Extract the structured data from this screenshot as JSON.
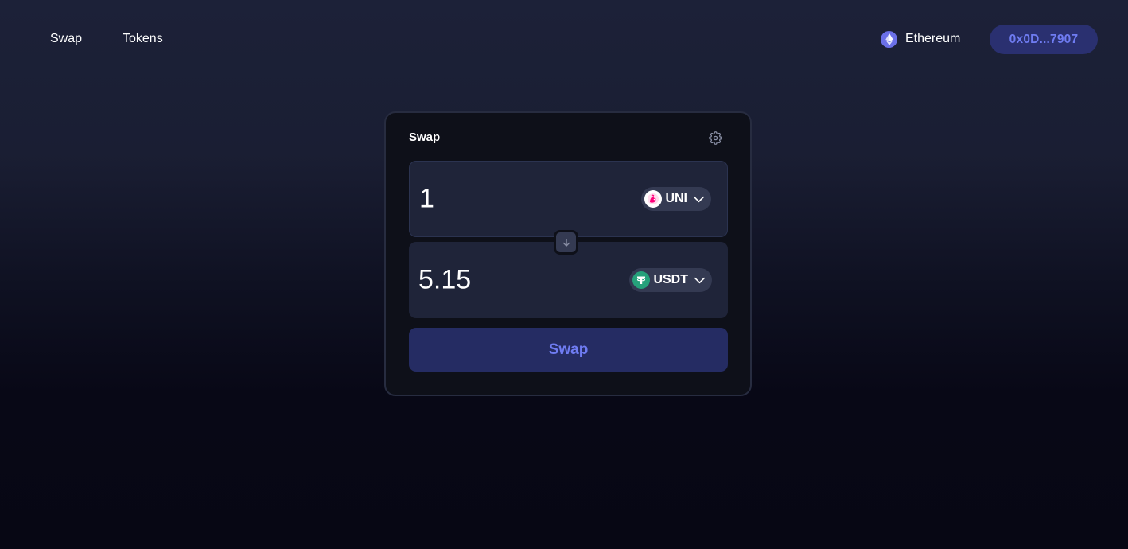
{
  "nav": {
    "items": [
      {
        "label": "Swap"
      },
      {
        "label": "Tokens"
      }
    ]
  },
  "network": {
    "label": "Ethereum",
    "icon": "ethereum-icon",
    "color": "#6b70e8"
  },
  "wallet": {
    "address": "0x0D...7907"
  },
  "swap_card": {
    "title": "Swap",
    "settings_icon": "gear-icon",
    "from": {
      "amount": "1",
      "token": "UNI",
      "token_icon": "uniswap-icon",
      "token_color": "#ff007a"
    },
    "to": {
      "amount": "5.15",
      "token": "USDT",
      "token_icon": "tether-icon",
      "token_color": "#26a17b"
    },
    "flip_icon": "arrow-down-icon",
    "submit_label": "Swap"
  },
  "colors": {
    "accent": "#6f7cf2",
    "button_bg": "#252c63",
    "card_bg": "#0e1019",
    "panel_bg": "#1f2439"
  }
}
